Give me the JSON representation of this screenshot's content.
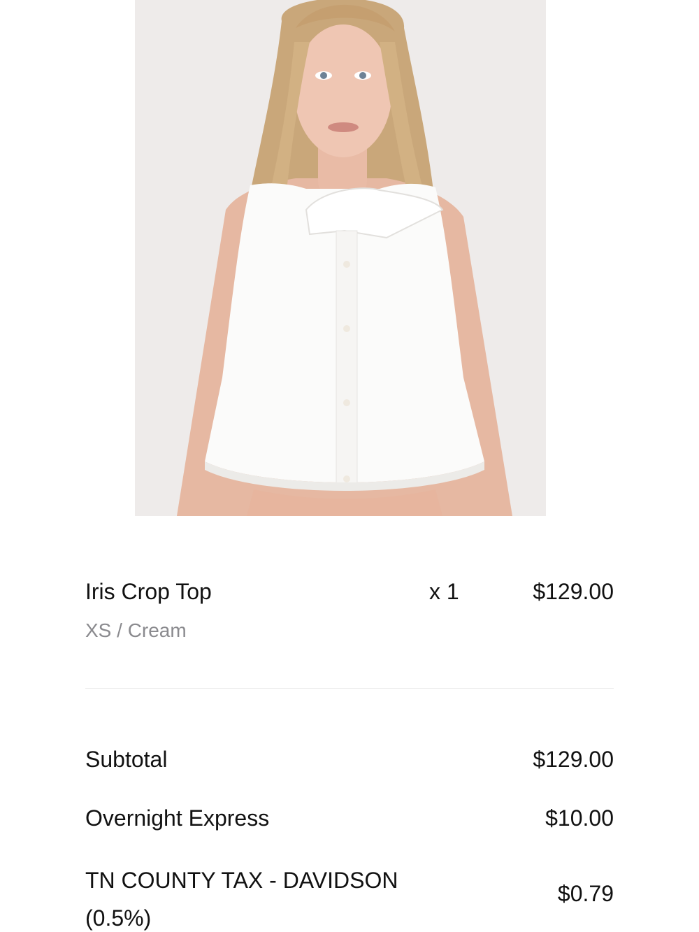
{
  "order_item": {
    "image_alt": "Iris Crop Top product photo",
    "name": "Iris Crop Top",
    "variant": "XS / Cream",
    "quantity": "x 1",
    "price": "$129.00"
  },
  "summary": {
    "subtotal_label": "Subtotal",
    "subtotal_value": "$129.00",
    "shipping_label": "Overnight Express",
    "shipping_value": "$10.00",
    "tax_label": "TN COUNTY TAX - DAVIDSON (0.5%)",
    "tax_value": "$0.79"
  },
  "colors": {
    "text": "#111111",
    "muted": "#8a8a8e",
    "divider": "#ececec",
    "background": "#ffffff"
  }
}
